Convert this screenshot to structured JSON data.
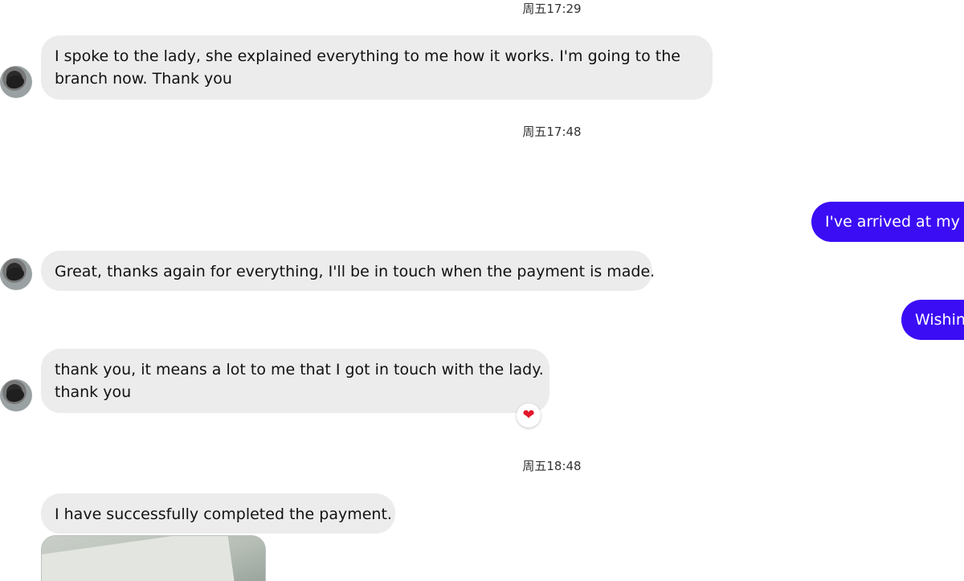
{
  "timestamps": [
    "周五17:29",
    "周五17:48",
    "周五18:48"
  ],
  "messages": {
    "m1": {
      "line1": "I spoke to the lady, she explained everything to me how it works. I'm going to the",
      "line2": "branch now. Thank you"
    },
    "out1": "I've arrived at my b",
    "m2": "Great, thanks again for everything, I'll be in touch when the payment is made.",
    "out2": "Wishin",
    "m3": {
      "line1": "thank you, it means a lot to me that I got in touch with the lady.",
      "line2": "thank you",
      "reaction": "❤"
    },
    "m4": "I have successfully completed the payment."
  },
  "colors": {
    "incoming_bubble": "#ececec",
    "outgoing_bubble": "#3b0df5",
    "reaction_heart": "#e0162b"
  },
  "icons": {
    "contact_avatar": "avatar-icon",
    "reaction": "heart-icon"
  }
}
